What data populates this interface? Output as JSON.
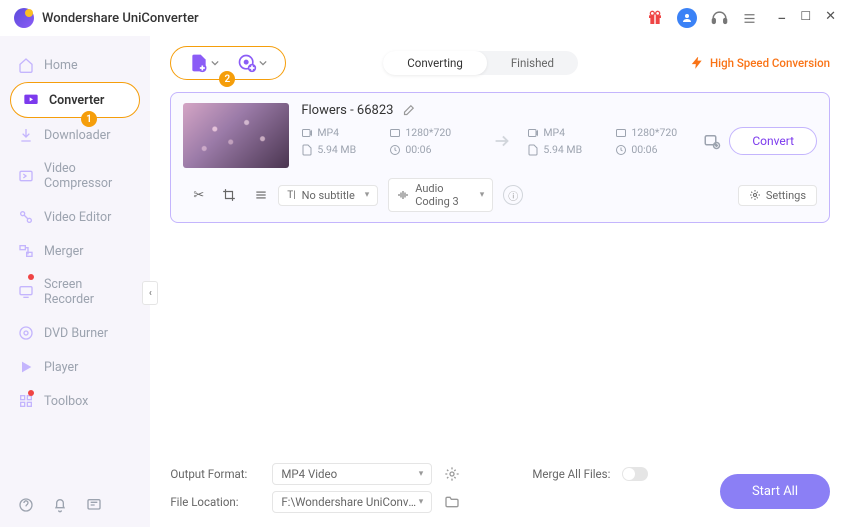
{
  "app": {
    "title": "Wondershare UniConverter"
  },
  "titlebar": {
    "gift": "gift-icon",
    "user": "user-icon",
    "headset": "headset-icon",
    "menu": "menu-icon",
    "min": "−",
    "max": "☐",
    "close": "✕"
  },
  "sidebar": {
    "items": [
      {
        "label": "Home",
        "icon": "home-icon"
      },
      {
        "label": "Converter",
        "icon": "converter-icon",
        "active": true
      },
      {
        "label": "Downloader",
        "icon": "downloader-icon"
      },
      {
        "label": "Video Compressor",
        "icon": "compressor-icon"
      },
      {
        "label": "Video Editor",
        "icon": "editor-icon"
      },
      {
        "label": "Merger",
        "icon": "merger-icon"
      },
      {
        "label": "Screen Recorder",
        "icon": "recorder-icon"
      },
      {
        "label": "DVD Burner",
        "icon": "burner-icon"
      },
      {
        "label": "Player",
        "icon": "player-icon"
      },
      {
        "label": "Toolbox",
        "icon": "toolbox-icon"
      }
    ],
    "badge1": "1"
  },
  "toolbar": {
    "badge2": "2",
    "tabs": [
      {
        "label": "Converting",
        "active": true
      },
      {
        "label": "Finished"
      }
    ],
    "hsc": "High Speed Conversion"
  },
  "file": {
    "name": "Flowers - 66823",
    "src": {
      "format": "MP4",
      "res": "1280*720",
      "size": "5.94 MB",
      "dur": "00:06"
    },
    "dst": {
      "format": "MP4",
      "res": "1280*720",
      "size": "5.94 MB",
      "dur": "00:06"
    },
    "convert": "Convert",
    "subtitle": "No subtitle",
    "audio": "Audio Coding 3",
    "settings": "Settings"
  },
  "footer": {
    "outLabel": "Output Format:",
    "outValue": "MP4 Video",
    "locLabel": "File Location:",
    "locValue": "F:\\Wondershare UniConverter",
    "mergeLabel": "Merge All Files:",
    "startAll": "Start All"
  }
}
